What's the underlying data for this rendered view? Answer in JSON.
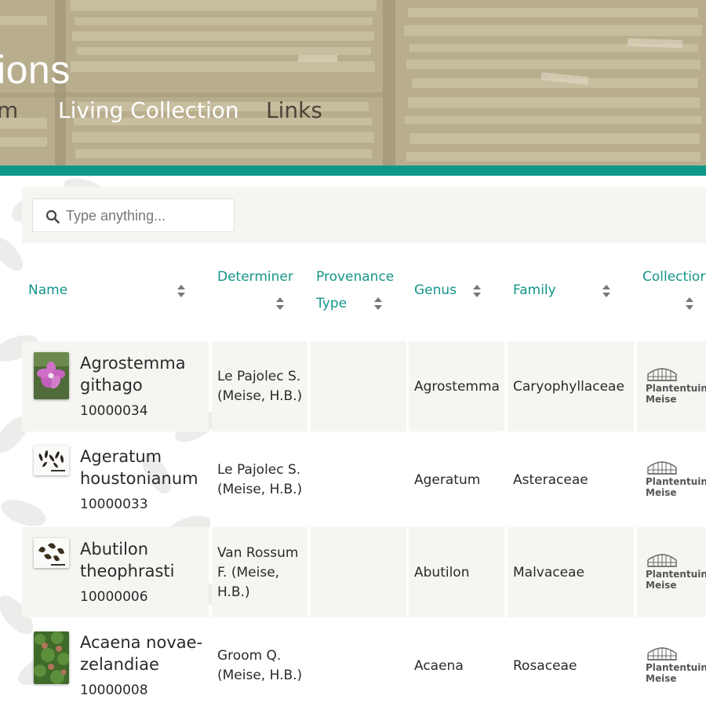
{
  "header": {
    "title_fragment": "ions",
    "nav": [
      {
        "label": "m"
      },
      {
        "label": "Living Collection"
      },
      {
        "label": "Links"
      }
    ]
  },
  "search": {
    "placeholder": "Type anything..."
  },
  "table": {
    "columns": [
      {
        "label": "Name"
      },
      {
        "label": "Determiner"
      },
      {
        "label": "Provenance Type",
        "line1": "Provenance",
        "line2": "Type"
      },
      {
        "label": "Genus"
      },
      {
        "label": "Family"
      },
      {
        "label": "Collection",
        "display": "Collectior"
      }
    ],
    "rows": [
      {
        "name_line1": "Agrostemma",
        "name_line2": "githago",
        "catalog_no": "10000034",
        "determiner_line1": "Le Pajolec S.",
        "determiner_line2": "(Meise, H.B.)",
        "determiner_line3": "",
        "provenance_type": "",
        "genus": "Agrostemma",
        "family": "Caryophyllaceae",
        "collection_logo": {
          "line1": "Plantentuin",
          "line2": "Meise"
        },
        "thumb_icon": "pink-flower-photo"
      },
      {
        "name_line1": "Ageratum",
        "name_line2": "houstonianum",
        "catalog_no": "10000033",
        "determiner_line1": "Le Pajolec S.",
        "determiner_line2": "(Meise, H.B.)",
        "determiner_line3": "",
        "provenance_type": "",
        "genus": "Ageratum",
        "family": "Asteraceae",
        "collection_logo": {
          "line1": "Plantentuin",
          "line2": "Meise"
        },
        "thumb_icon": "seeds-photo"
      },
      {
        "name_line1": "Abutilon",
        "name_line2": "theophrasti",
        "catalog_no": "10000006",
        "determiner_line1": "Van Rossum",
        "determiner_line2": "F. (Meise,",
        "determiner_line3": "H.B.)",
        "provenance_type": "",
        "genus": "Abutilon",
        "family": "Malvaceae",
        "collection_logo": {
          "line1": "Plantentuin",
          "line2": "Meise"
        },
        "thumb_icon": "seeds-photo"
      },
      {
        "name_line1": "Acaena novae-",
        "name_line2": "zelandiae",
        "catalog_no": "10000008",
        "determiner_line1": "Groom Q.",
        "determiner_line2": "(Meise, H.B.)",
        "determiner_line3": "",
        "provenance_type": "",
        "genus": "Acaena",
        "family": "Rosaceae",
        "collection_logo": {
          "line1": "Plantentuin",
          "line2": "Meise"
        },
        "thumb_icon": "green-plant-photo"
      }
    ]
  },
  "colors": {
    "accent": "#0f978a",
    "header_bg": "#a99f84",
    "row_alt": "#f6f5f2"
  }
}
